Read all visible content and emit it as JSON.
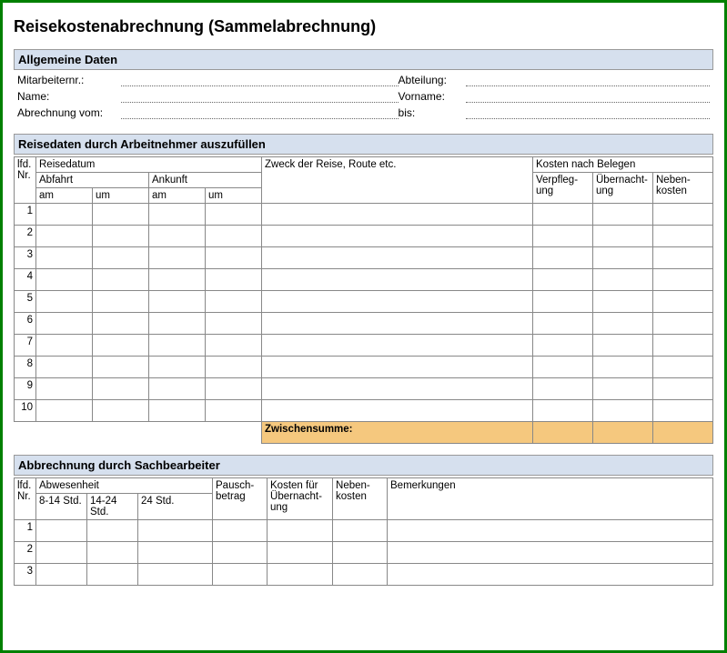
{
  "title": "Reisekostenabrechnung (Sammelabrechnung)",
  "section1": {
    "header": "Allgemeine Daten",
    "fields": {
      "mitarbeiter": "Mitarbeiternr.:",
      "abteilung": "Abteilung:",
      "name": "Name:",
      "vorname": "Vorname:",
      "abrechnung_vom": "Abrechnung vom:",
      "bis": "bis:"
    }
  },
  "section2": {
    "header": "Reisedaten durch Arbeitnehmer auszufüllen",
    "cols": {
      "lfd_nr": "lfd. Nr.",
      "reisedatum": "Reisedatum",
      "abfahrt": "Abfahrt",
      "ankunft": "Ankunft",
      "am": "am",
      "um": "um",
      "zweck": "Zweck der Reise, Route etc.",
      "kosten": "Kosten nach Belegen",
      "verpflegung": "Verpfleg-ung",
      "uebernachtung": "Übernacht-ung",
      "nebenkosten": "Neben-kosten"
    },
    "rows": [
      "1",
      "2",
      "3",
      "4",
      "5",
      "6",
      "7",
      "8",
      "9",
      "10"
    ],
    "subtotal": "Zwischensumme:"
  },
  "section3": {
    "header": "Abbrechnung durch Sachbearbeiter",
    "cols": {
      "lfd_nr": "lfd. Nr.",
      "abwesenheit": "Abwesenheit",
      "std_8_14": "8-14 Std.",
      "std_14_24": "14-24 Std.",
      "std_24": "24 Std.",
      "pauschbetrag": "Pausch-betrag",
      "kosten_uebernachtung": "Kosten für Übernacht-ung",
      "nebenkosten": "Neben-kosten",
      "bemerkungen": "Bemerkungen"
    },
    "rows": [
      "1",
      "2",
      "3"
    ]
  }
}
